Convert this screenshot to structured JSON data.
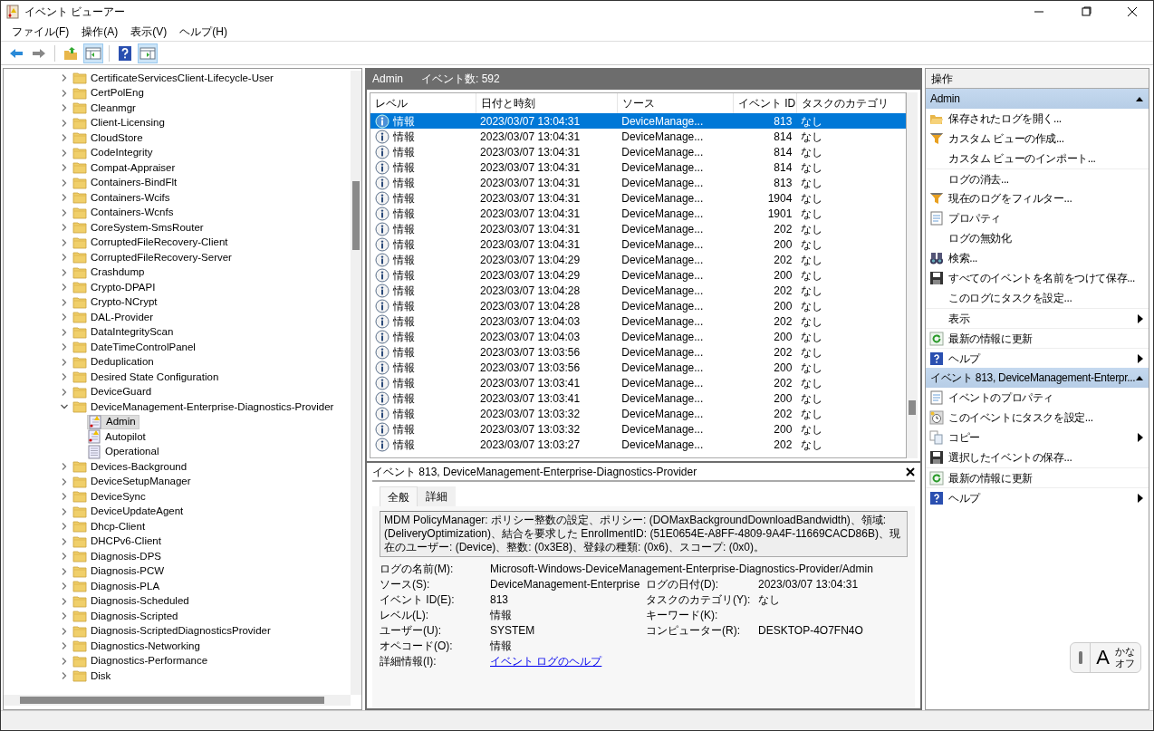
{
  "window": {
    "title": "イベント ビューアー"
  },
  "menu": [
    "ファイル(F)",
    "操作(A)",
    "表示(V)",
    "ヘルプ(H)"
  ],
  "toolbar": [
    {
      "kind": "back",
      "pressed": false
    },
    {
      "kind": "forward",
      "pressed": false
    },
    {
      "kind": "up",
      "pressed": false
    },
    {
      "kind": "tree-pane",
      "pressed": true
    },
    {
      "kind": "help",
      "pressed": false
    },
    {
      "kind": "action-pane",
      "pressed": true
    }
  ],
  "tree": [
    {
      "label": "CertificateServicesClient-Lifecycle-User",
      "expanded": false
    },
    {
      "label": "CertPolEng",
      "expanded": false
    },
    {
      "label": "Cleanmgr",
      "expanded": false
    },
    {
      "label": "Client-Licensing",
      "expanded": false
    },
    {
      "label": "CloudStore",
      "expanded": false
    },
    {
      "label": "CodeIntegrity",
      "expanded": false
    },
    {
      "label": "Compat-Appraiser",
      "expanded": false
    },
    {
      "label": "Containers-BindFlt",
      "expanded": false
    },
    {
      "label": "Containers-Wcifs",
      "expanded": false
    },
    {
      "label": "Containers-Wcnfs",
      "expanded": false
    },
    {
      "label": "CoreSystem-SmsRouter",
      "expanded": false
    },
    {
      "label": "CorruptedFileRecovery-Client",
      "expanded": false
    },
    {
      "label": "CorruptedFileRecovery-Server",
      "expanded": false
    },
    {
      "label": "Crashdump",
      "expanded": false
    },
    {
      "label": "Crypto-DPAPI",
      "expanded": false
    },
    {
      "label": "Crypto-NCrypt",
      "expanded": false
    },
    {
      "label": "DAL-Provider",
      "expanded": false
    },
    {
      "label": "DataIntegrityScan",
      "expanded": false
    },
    {
      "label": "DateTimeControlPanel",
      "expanded": false
    },
    {
      "label": "Deduplication",
      "expanded": false
    },
    {
      "label": "Desired State Configuration",
      "expanded": false
    },
    {
      "label": "DeviceGuard",
      "expanded": false
    },
    {
      "label": "DeviceManagement-Enterprise-Diagnostics-Provider",
      "expanded": true,
      "children": [
        {
          "label": "Admin",
          "kind": "log-alert",
          "selected": true
        },
        {
          "label": "Autopilot",
          "kind": "log-alert",
          "selected": false
        },
        {
          "label": "Operational",
          "kind": "log",
          "selected": false
        }
      ]
    },
    {
      "label": "Devices-Background",
      "expanded": false
    },
    {
      "label": "DeviceSetupManager",
      "expanded": false
    },
    {
      "label": "DeviceSync",
      "expanded": false
    },
    {
      "label": "DeviceUpdateAgent",
      "expanded": false
    },
    {
      "label": "Dhcp-Client",
      "expanded": false
    },
    {
      "label": "DHCPv6-Client",
      "expanded": false
    },
    {
      "label": "Diagnosis-DPS",
      "expanded": false
    },
    {
      "label": "Diagnosis-PCW",
      "expanded": false
    },
    {
      "label": "Diagnosis-PLA",
      "expanded": false
    },
    {
      "label": "Diagnosis-Scheduled",
      "expanded": false
    },
    {
      "label": "Diagnosis-Scripted",
      "expanded": false
    },
    {
      "label": "Diagnosis-ScriptedDiagnosticsProvider",
      "expanded": false
    },
    {
      "label": "Diagnostics-Networking",
      "expanded": false
    },
    {
      "label": "Diagnostics-Performance",
      "expanded": false
    },
    {
      "label": "Disk",
      "expanded": false
    }
  ],
  "log_header": {
    "name": "Admin",
    "count": "イベント数: 592"
  },
  "table": {
    "columns": [
      "レベル",
      "日付と時刻",
      "ソース",
      "イベント ID",
      "タスクのカテゴリ"
    ],
    "rows": [
      {
        "level": "情報",
        "date": "2023/03/07 13:04:31",
        "source": "DeviceManage...",
        "id": "813",
        "category": "なし",
        "selected": true
      },
      {
        "level": "情報",
        "date": "2023/03/07 13:04:31",
        "source": "DeviceManage...",
        "id": "814",
        "category": "なし",
        "selected": false
      },
      {
        "level": "情報",
        "date": "2023/03/07 13:04:31",
        "source": "DeviceManage...",
        "id": "814",
        "category": "なし",
        "selected": false
      },
      {
        "level": "情報",
        "date": "2023/03/07 13:04:31",
        "source": "DeviceManage...",
        "id": "814",
        "category": "なし",
        "selected": false
      },
      {
        "level": "情報",
        "date": "2023/03/07 13:04:31",
        "source": "DeviceManage...",
        "id": "813",
        "category": "なし",
        "selected": false
      },
      {
        "level": "情報",
        "date": "2023/03/07 13:04:31",
        "source": "DeviceManage...",
        "id": "1904",
        "category": "なし",
        "selected": false
      },
      {
        "level": "情報",
        "date": "2023/03/07 13:04:31",
        "source": "DeviceManage...",
        "id": "1901",
        "category": "なし",
        "selected": false
      },
      {
        "level": "情報",
        "date": "2023/03/07 13:04:31",
        "source": "DeviceManage...",
        "id": "202",
        "category": "なし",
        "selected": false
      },
      {
        "level": "情報",
        "date": "2023/03/07 13:04:31",
        "source": "DeviceManage...",
        "id": "200",
        "category": "なし",
        "selected": false
      },
      {
        "level": "情報",
        "date": "2023/03/07 13:04:29",
        "source": "DeviceManage...",
        "id": "202",
        "category": "なし",
        "selected": false
      },
      {
        "level": "情報",
        "date": "2023/03/07 13:04:29",
        "source": "DeviceManage...",
        "id": "200",
        "category": "なし",
        "selected": false
      },
      {
        "level": "情報",
        "date": "2023/03/07 13:04:28",
        "source": "DeviceManage...",
        "id": "202",
        "category": "なし",
        "selected": false
      },
      {
        "level": "情報",
        "date": "2023/03/07 13:04:28",
        "source": "DeviceManage...",
        "id": "200",
        "category": "なし",
        "selected": false
      },
      {
        "level": "情報",
        "date": "2023/03/07 13:04:03",
        "source": "DeviceManage...",
        "id": "202",
        "category": "なし",
        "selected": false
      },
      {
        "level": "情報",
        "date": "2023/03/07 13:04:03",
        "source": "DeviceManage...",
        "id": "200",
        "category": "なし",
        "selected": false
      },
      {
        "level": "情報",
        "date": "2023/03/07 13:03:56",
        "source": "DeviceManage...",
        "id": "202",
        "category": "なし",
        "selected": false
      },
      {
        "level": "情報",
        "date": "2023/03/07 13:03:56",
        "source": "DeviceManage...",
        "id": "200",
        "category": "なし",
        "selected": false
      },
      {
        "level": "情報",
        "date": "2023/03/07 13:03:41",
        "source": "DeviceManage...",
        "id": "202",
        "category": "なし",
        "selected": false
      },
      {
        "level": "情報",
        "date": "2023/03/07 13:03:41",
        "source": "DeviceManage...",
        "id": "200",
        "category": "なし",
        "selected": false
      },
      {
        "level": "情報",
        "date": "2023/03/07 13:03:32",
        "source": "DeviceManage...",
        "id": "202",
        "category": "なし",
        "selected": false
      },
      {
        "level": "情報",
        "date": "2023/03/07 13:03:32",
        "source": "DeviceManage...",
        "id": "200",
        "category": "なし",
        "selected": false
      },
      {
        "level": "情報",
        "date": "2023/03/07 13:03:27",
        "source": "DeviceManage...",
        "id": "202",
        "category": "なし",
        "selected": false
      }
    ]
  },
  "detail": {
    "title": "イベント 813, DeviceManagement-Enterprise-Diagnostics-Provider",
    "tabs": [
      {
        "label": "全般",
        "selected": true
      },
      {
        "label": "詳細",
        "selected": false
      }
    ],
    "message": "MDM PolicyManager: ポリシー整数の設定、ポリシー: (DOMaxBackgroundDownloadBandwidth)、領域: (DeliveryOptimization)、結合を要求した EnrollmentID: (51E0654E-A8FF-4809-9A4F-11669CACD86B)、現在のユーザー: (Device)、整数: (0x3E8)、登録の種類: (0x6)、スコープ: (0x0)。",
    "fields": [
      {
        "left": {
          "label": "ログの名前(M):",
          "value": "Microsoft-Windows-DeviceManagement-Enterprise-Diagnostics-Provider/Admin"
        }
      },
      {
        "left": {
          "label": "ソース(S):",
          "value": "DeviceManagement-Enterprise"
        },
        "right": {
          "label": "ログの日付(D):",
          "value": "2023/03/07 13:04:31"
        }
      },
      {
        "left": {
          "label": "イベント ID(E):",
          "value": "813"
        },
        "right": {
          "label": "タスクのカテゴリ(Y):",
          "value": "なし"
        }
      },
      {
        "left": {
          "label": "レベル(L):",
          "value": "情報"
        },
        "right": {
          "label": "キーワード(K):"
        }
      },
      {
        "left": {
          "label": "ユーザー(U):",
          "value": "SYSTEM"
        },
        "right": {
          "label": "コンピューター(R):",
          "value": "DESKTOP-4O7FN4O"
        }
      },
      {
        "left": {
          "label": "オペコード(O):",
          "value": "情報"
        }
      },
      {
        "left": {
          "label": "詳細情報(I):",
          "value": "イベント ログのヘルプ",
          "kind": "link"
        }
      }
    ]
  },
  "actions": {
    "title": "操作",
    "sections": [
      {
        "title": "Admin",
        "expanded": true,
        "items": [
          {
            "label": "保存されたログを開く...",
            "kind": "open-folder",
            "separator_before": false,
            "submenu": false
          },
          {
            "label": "カスタム ビューの作成...",
            "kind": "filter",
            "separator_before": false,
            "submenu": false
          },
          {
            "label": "カスタム ビューのインポート...",
            "kind": "plain",
            "separator_before": false,
            "submenu": false
          },
          {
            "label": "ログの消去...",
            "kind": "plain",
            "separator_before": true,
            "submenu": false
          },
          {
            "label": "現在のログをフィルター...",
            "kind": "filter",
            "separator_before": false,
            "submenu": false
          },
          {
            "label": "プロパティ",
            "kind": "properties",
            "separator_before": false,
            "submenu": false
          },
          {
            "label": "ログの無効化",
            "kind": "plain",
            "separator_before": false,
            "submenu": false
          },
          {
            "label": "検索...",
            "kind": "find",
            "separator_before": false,
            "submenu": false
          },
          {
            "label": "すべてのイベントを名前をつけて保存...",
            "kind": "save",
            "separator_before": false,
            "submenu": false
          },
          {
            "label": "このログにタスクを設定...",
            "kind": "plain",
            "separator_before": false,
            "submenu": false
          },
          {
            "label": "表示",
            "kind": "plain",
            "separator_before": true,
            "submenu": true
          },
          {
            "label": "最新の情報に更新",
            "kind": "refresh",
            "separator_before": true,
            "submenu": false
          },
          {
            "label": "ヘルプ",
            "kind": "help",
            "separator_before": true,
            "submenu": true
          }
        ]
      },
      {
        "title": "イベント 813, DeviceManagement-Enterpr...",
        "expanded": true,
        "items": [
          {
            "label": "イベントのプロパティ",
            "kind": "properties",
            "separator_before": false,
            "submenu": false
          },
          {
            "label": "このイベントにタスクを設定...",
            "kind": "task",
            "separator_before": false,
            "submenu": false
          },
          {
            "label": "コピー",
            "kind": "copy",
            "separator_before": false,
            "submenu": true
          },
          {
            "label": "選択したイベントの保存...",
            "kind": "save",
            "separator_before": false,
            "submenu": false
          },
          {
            "label": "最新の情報に更新",
            "kind": "refresh",
            "separator_before": true,
            "submenu": false
          },
          {
            "label": "ヘルプ",
            "kind": "help",
            "separator_before": true,
            "submenu": true
          }
        ]
      }
    ]
  },
  "ime": {
    "mode": "A",
    "status": [
      "かな",
      "オフ"
    ]
  }
}
